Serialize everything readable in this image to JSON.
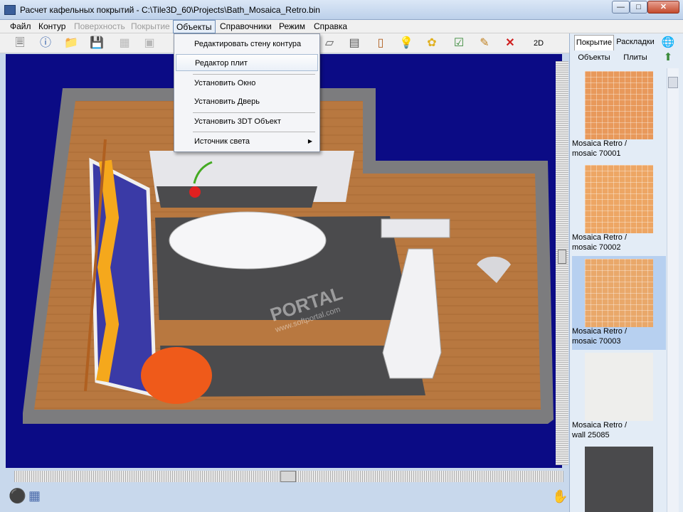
{
  "window": {
    "title": "Расчет кафельных покрытий - C:\\Tile3D_60\\Projects\\Bath_Mosaica_Retro.bin"
  },
  "menu": {
    "items": [
      {
        "label": "Файл",
        "enabled": true
      },
      {
        "label": "Контур",
        "enabled": true
      },
      {
        "label": "Поверхность",
        "enabled": false
      },
      {
        "label": "Покрытие",
        "enabled": false
      },
      {
        "label": "Объекты",
        "enabled": true,
        "open": true
      },
      {
        "label": "Справочники",
        "enabled": true
      },
      {
        "label": "Режим",
        "enabled": true
      },
      {
        "label": "Справка",
        "enabled": true
      }
    ]
  },
  "dropdown": {
    "items": [
      {
        "label": "Редактировать стену контура"
      },
      {
        "label": "Редактор плит",
        "highlighted": true
      },
      {
        "label": "Установить Окно"
      },
      {
        "label": "Установить Дверь"
      },
      {
        "label": "Установить 3DT Объект"
      },
      {
        "label": "Источник света",
        "has_submenu": true
      }
    ]
  },
  "toolbar": {
    "view_2d_label": "2D"
  },
  "watermark": {
    "main": "PORTAL",
    "sub": "www.softportal.com"
  },
  "right_panel": {
    "tabs": [
      "Покрытие",
      "Раскладки"
    ],
    "subtabs": [
      "Объекты",
      "Плиты"
    ],
    "tiles": [
      {
        "line1": "Mosaica Retro /",
        "line2": "mosaic 70001",
        "color": "#e8995b",
        "selected": false
      },
      {
        "line1": "Mosaica Retro /",
        "line2": "mosaic 70002",
        "color": "#eda664",
        "selected": false
      },
      {
        "line1": "Mosaica Retro /",
        "line2": "mosaic 70003",
        "color": "#e9a86a",
        "selected": true
      },
      {
        "line1": "Mosaica Retro /",
        "line2": "wall 25085",
        "color": "#eeeeec",
        "selected": false
      },
      {
        "line1": "",
        "line2": "",
        "color": "#4a4a4c",
        "selected": false
      }
    ]
  },
  "colors": {
    "viewport_bg": "#0b0b85",
    "highlight": "#b7d0f0",
    "floor": "#4b4b4d",
    "wood": "#b87840"
  }
}
